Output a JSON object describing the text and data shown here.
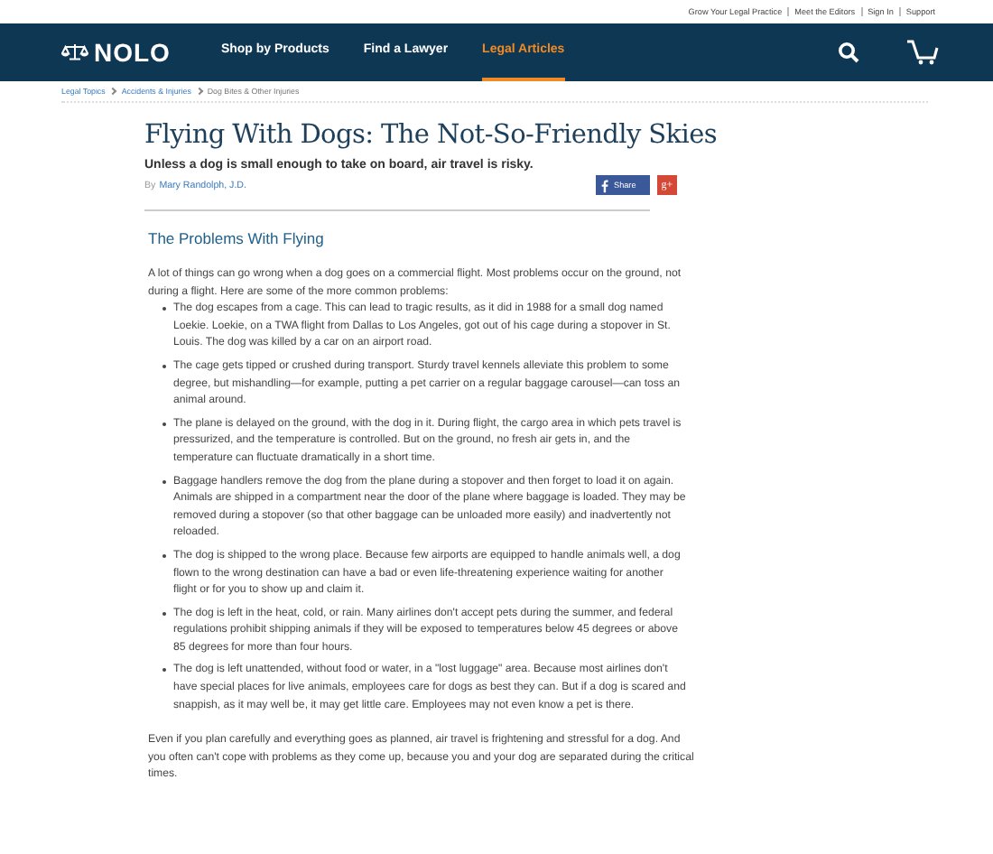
{
  "utility_links": [
    "Grow Your Legal Practice",
    "Meet the Editors",
    "Sign In",
    "Support"
  ],
  "nav": {
    "logo": "NOLO",
    "items": [
      {
        "label": "Shop by Products",
        "selected": false
      },
      {
        "label": "Find a Lawyer",
        "selected": false
      },
      {
        "label": "Legal Articles",
        "selected": true
      }
    ]
  },
  "breadcrumbs": [
    {
      "label": "Legal Topics",
      "link": true
    },
    {
      "label": "Accidents & Injuries",
      "link": true
    },
    {
      "label": "Dog Bites & Other Injuries",
      "link": false
    }
  ],
  "article": {
    "title": "Flying With Dogs: The Not-So-Friendly Skies",
    "subtitle": "Unless a dog is small enough to take on board, air travel is risky.",
    "by": "By",
    "author": "Mary Randolph, J.D.",
    "share": "Share",
    "gplus": "g+",
    "heading": "The Problems With Flying",
    "intro": "A lot of things can go wrong when a dog goes on a commercial flight. Most problems occur on the ground, not during a flight. Here are some of the more common problems:",
    "bullets": [
      "The dog escapes from a cage. This can lead to tragic results, as it did in 1988 for a small dog named Loekie. Loekie, on a TWA flight from Dallas to Los Angeles, got out of his cage during a stopover in St. Louis. The dog was killed by a car on an airport road.",
      "The cage gets tipped or crushed during transport. Sturdy travel kennels alleviate this problem to some degree, but mishandling—for example, putting a pet carrier on a regular baggage carousel—can toss an animal around.",
      "The plane is delayed on the ground, with the dog in it. During flight, the cargo area in which pets travel is pressurized, and the temperature is controlled. But on the ground, no fresh air gets in, and the temperature can fluctuate dramatically in a short time.",
      "Baggage handlers remove the dog from the plane during a stopover and then forget to load it on again. Animals are shipped in a compartment near the door of the plane where baggage is loaded. They may be removed during a stopover (so that other baggage can be unloaded more easily) and inadvertently not reloaded.",
      "The dog is shipped to the wrong place. Because few airports are equipped to handle animals well, a dog flown to the wrong destination can have a bad or even life-threatening experience waiting for another flight or for you to show up and claim it.",
      "The dog is left in the heat, cold, or rain. Many airlines don't accept pets during the summer, and federal regulations prohibit shipping animals if they will be exposed to temperatures below 45 degrees or above 85 degrees for more than four hours.",
      "The dog is left unattended, without food or water, in a \"lost luggage\" area. Because most airlines don't have special places for live animals, employees care for dogs as best they can. But if a dog is scared and snappish, as it may well be, it may get little care. Employees may not even know a pet is there."
    ],
    "closing": "Even if you plan carefully and everything goes as planned, air travel is frightening and stressful for a dog. And you often can't cope with problems as they come up, because you and your dog are separated during the critical times."
  }
}
